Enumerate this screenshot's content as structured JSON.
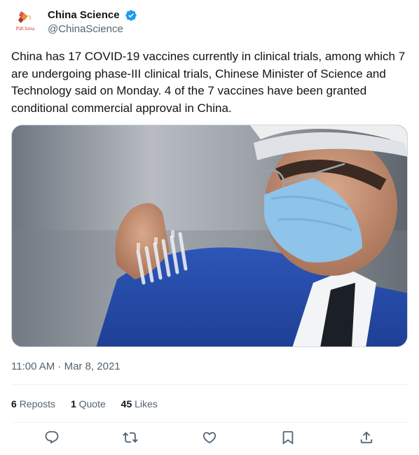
{
  "account": {
    "display_name": "China Science",
    "handle": "@ChinaScience",
    "avatar_text": "PdChina",
    "verified": true
  },
  "tweet": {
    "text": "China has 17 COVID-19 vaccines currently in clinical trials, among which 7 are undergoing phase-III clinical trials, Chinese Minister of Science and Technology said on Monday. 4 of the 7 vaccines have been granted conditional commercial approval in China.",
    "timestamp": "11:00 AM · Mar 8, 2021"
  },
  "stats": {
    "reposts_count": "6",
    "reposts_label": "Reposts",
    "quotes_count": "1",
    "quotes_label": "Quote",
    "likes_count": "45",
    "likes_label": "Likes"
  },
  "actions": [
    "reply-icon",
    "repost-icon",
    "like-icon",
    "bookmark-icon",
    "share-icon"
  ],
  "colors": {
    "accent": "#1d9bf0",
    "secondary_text": "#536471",
    "divider": "#eff3f4"
  }
}
